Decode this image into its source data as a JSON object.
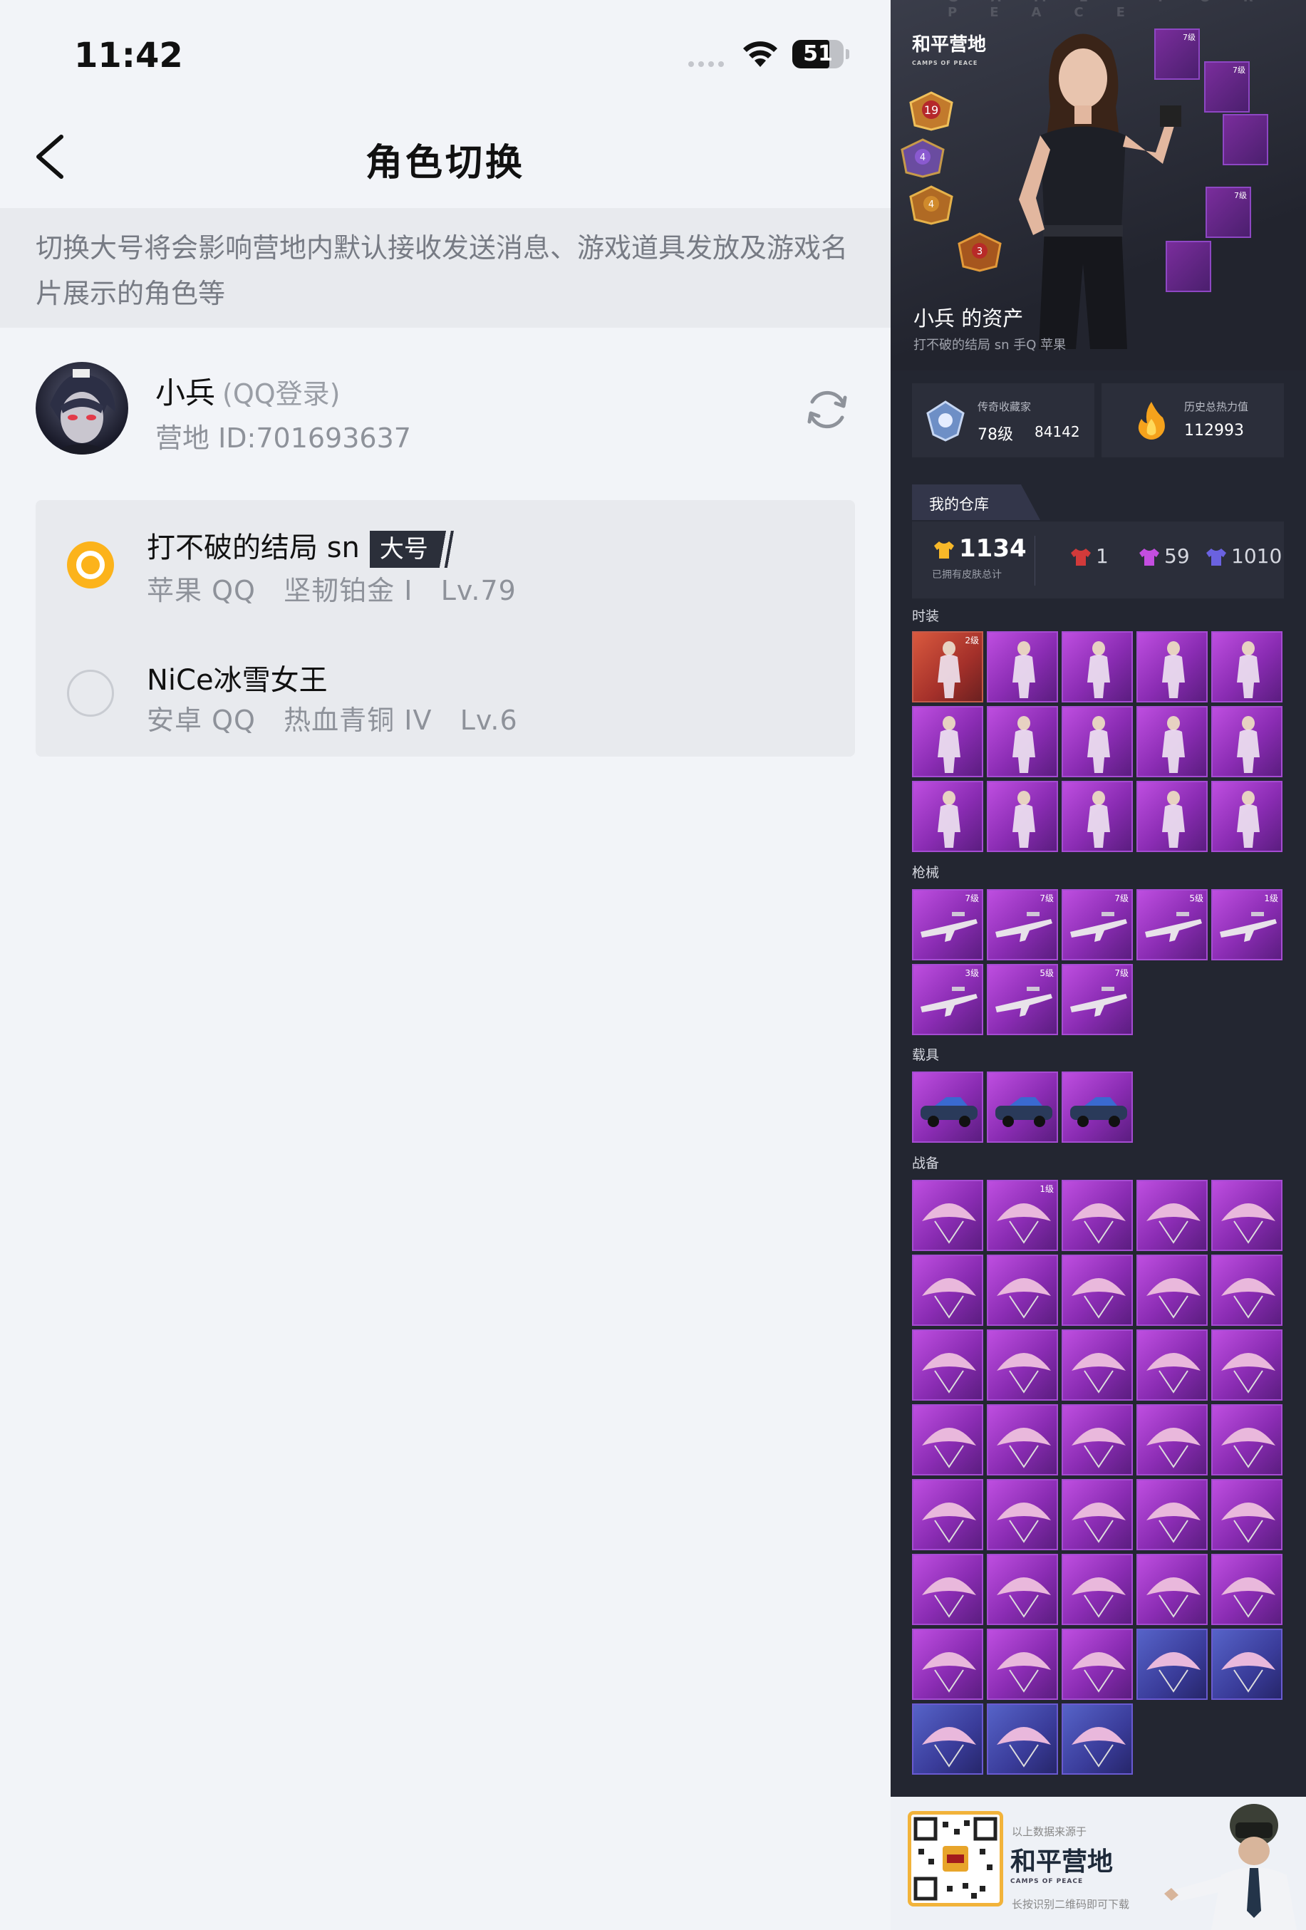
{
  "status_bar": {
    "time": "11:42",
    "battery": "51"
  },
  "header": {
    "title": "角色切换"
  },
  "notice": "切换大号将会影响营地内默认接收发送消息、游戏道具发放及游戏名片展示的角色等",
  "account": {
    "name": "小兵",
    "login": "(QQ登录)",
    "camp_id": "营地 ID:701693637"
  },
  "roles": [
    {
      "name": "打不破的结局 sn",
      "badge": "大号",
      "platform": "苹果 QQ",
      "rank": "坚韧铂金 I",
      "level": "Lv.79",
      "selected": true
    },
    {
      "name": "NiCe冰雪女王",
      "badge": "",
      "platform": "安卓 QQ",
      "rank": "热血青铜 IV",
      "level": "Lv.6",
      "selected": false
    }
  ],
  "panel": {
    "watermark": "GAME FOR PEACE",
    "logo": "和平营地",
    "logo_sub": "CAMPS OF PEACE",
    "medals": [
      "19",
      "4",
      "4",
      "3"
    ],
    "mini_levels": [
      "7级",
      "7级",
      "",
      "7级",
      ""
    ],
    "title": "小兵 的资产",
    "subtitle": "打不破的结局 sn 手Q 苹果",
    "stats": [
      {
        "label": "传奇收藏家",
        "value": "78级",
        "value2": "84142"
      },
      {
        "label": "历史总热力值",
        "value": "112993",
        "value2": ""
      }
    ],
    "warehouse": {
      "tab": "我的仓库",
      "total": "1134",
      "total_label": "已拥有皮肤总计",
      "counts": [
        "1",
        "59",
        "1010"
      ]
    },
    "categories": [
      {
        "name": "时装",
        "items": [
          {
            "lv": "2级",
            "tone": "red"
          },
          {
            "lv": ""
          },
          {
            "lv": ""
          },
          {
            "lv": ""
          },
          {
            "lv": ""
          },
          {
            "lv": ""
          },
          {
            "lv": ""
          },
          {
            "lv": ""
          },
          {
            "lv": ""
          },
          {
            "lv": ""
          },
          {
            "lv": ""
          },
          {
            "lv": ""
          },
          {
            "lv": ""
          },
          {
            "lv": ""
          },
          {
            "lv": ""
          }
        ]
      },
      {
        "name": "枪械",
        "items": [
          {
            "lv": "7级"
          },
          {
            "lv": "7级"
          },
          {
            "lv": "7级"
          },
          {
            "lv": "5级"
          },
          {
            "lv": "1级"
          },
          {
            "lv": "3级"
          },
          {
            "lv": "5级"
          },
          {
            "lv": "7级"
          }
        ]
      },
      {
        "name": "载具",
        "items": [
          {
            "lv": ""
          },
          {
            "lv": ""
          },
          {
            "lv": ""
          }
        ]
      },
      {
        "name": "战备",
        "items": [
          {
            "lv": ""
          },
          {
            "lv": "1级"
          },
          {
            "lv": ""
          },
          {
            "lv": ""
          },
          {
            "lv": ""
          },
          {
            "lv": ""
          },
          {
            "lv": ""
          },
          {
            "lv": ""
          },
          {
            "lv": ""
          },
          {
            "lv": ""
          },
          {
            "lv": ""
          },
          {
            "lv": ""
          },
          {
            "lv": ""
          },
          {
            "lv": ""
          },
          {
            "lv": ""
          },
          {
            "lv": ""
          },
          {
            "lv": ""
          },
          {
            "lv": ""
          },
          {
            "lv": ""
          },
          {
            "lv": ""
          },
          {
            "lv": ""
          },
          {
            "lv": ""
          },
          {
            "lv": ""
          },
          {
            "lv": ""
          },
          {
            "lv": ""
          },
          {
            "lv": ""
          },
          {
            "lv": ""
          },
          {
            "lv": ""
          },
          {
            "lv": ""
          },
          {
            "lv": ""
          },
          {
            "lv": ""
          },
          {
            "lv": ""
          },
          {
            "lv": ""
          },
          {
            "lv": "",
            "tone": "blue"
          },
          {
            "lv": "",
            "tone": "blue"
          },
          {
            "lv": "",
            "tone": "blue"
          },
          {
            "lv": "",
            "tone": "blue"
          },
          {
            "lv": "",
            "tone": "blue"
          }
        ]
      }
    ],
    "footer": {
      "source": "以上数据来源于",
      "logo": "和平营地",
      "logo_sub": "CAMPS OF PEACE",
      "hint": "长按识别二维码即可下载"
    }
  },
  "colors": {
    "accent": "#fcb31b",
    "panel_bg": "#232631",
    "tile": "#a54cd2"
  }
}
